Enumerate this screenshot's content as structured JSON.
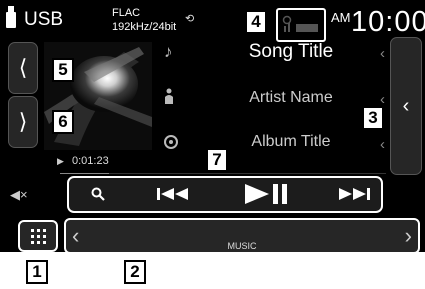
{
  "source": {
    "label": "USB"
  },
  "format": {
    "codec": "FLAC",
    "rate": "192kHz/24bit"
  },
  "clock": {
    "ampm": "AM",
    "time": "10:00"
  },
  "track": {
    "title": "Song Title",
    "artist": "Artist Name",
    "album": "Album Title",
    "elapsed": "0:01:23",
    "progress": 0.15
  },
  "controls": {
    "search": "search-icon",
    "previous": "previous-track-icon",
    "play_pause": "play-pause-icon",
    "next": "next-track-icon"
  },
  "function_bar": {
    "label": "MUSIC"
  },
  "callouts": {
    "c1": "1",
    "c2": "2",
    "c3": "3",
    "c4": "4",
    "c5": "5",
    "c6": "6",
    "c7": "7"
  },
  "colors": {
    "screen": "#000000",
    "panel": "#262626",
    "text": "#ffffff"
  }
}
